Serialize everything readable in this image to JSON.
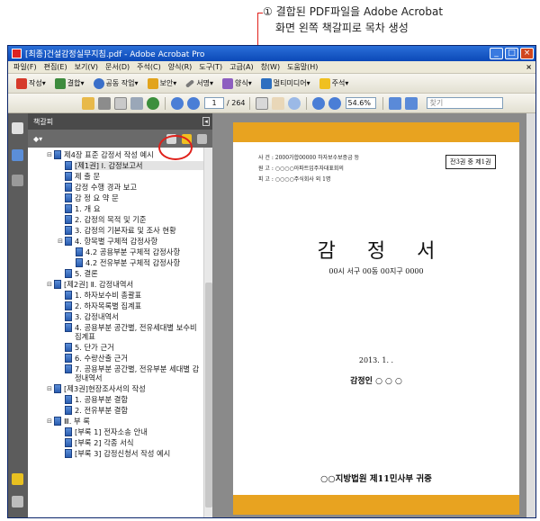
{
  "callout": {
    "number": "①",
    "line1": "결합된 PDF파일을 Adobe Acrobat",
    "line2": "화면 왼쪽 책갈피로 목차 생성"
  },
  "window": {
    "title": "[최종]건설감정실무지침.pdf - Adobe Acrobat Pro",
    "buttons": [
      "_",
      "□",
      "×"
    ]
  },
  "menubar": [
    "파일(F)",
    "편집(E)",
    "보기(V)",
    "문서(D)",
    "주석(C)",
    "양식(R)",
    "도구(T)",
    "고급(A)",
    "창(W)",
    "도움말(H)"
  ],
  "toolbar": {
    "create": "작성",
    "combine": "결합",
    "collaborate": "공동 작업",
    "secure": "보안",
    "sign": "서명",
    "forms": "양식",
    "multimedia": "멀티미디어",
    "comment": "주석"
  },
  "nav": {
    "current_page": "1",
    "total_pages": "/ 264",
    "zoom": "54.6%",
    "search_placeholder": "찾기"
  },
  "bookmarks": {
    "header": "책갈피",
    "options": "◆▾",
    "items": [
      {
        "label": "제4장 표준 감정서 작성 예시",
        "level": 0,
        "toggle": "⊟",
        "selected": false
      },
      {
        "label": "[제1권] Ⅰ. 감정보고서",
        "level": 1,
        "toggle": "",
        "selected": true
      },
      {
        "label": "제 출 문",
        "level": 1,
        "toggle": "",
        "selected": false
      },
      {
        "label": "감정 수행 경과 보고",
        "level": 1,
        "toggle": "",
        "selected": false
      },
      {
        "label": "감 정 요 약 문",
        "level": 1,
        "toggle": "",
        "selected": false
      },
      {
        "label": "1. 개 요",
        "level": 1,
        "toggle": "",
        "selected": false
      },
      {
        "label": "2. 감정의 목적 및 기준",
        "level": 1,
        "toggle": "",
        "selected": false
      },
      {
        "label": "3. 감정의 기본자료 및 조사 현황",
        "level": 1,
        "toggle": "",
        "selected": false
      },
      {
        "label": "4. 항목별 구체적 감정사항",
        "level": 1,
        "toggle": "⊟",
        "selected": false
      },
      {
        "label": "4.2 공용부분 구체적 감정사항",
        "level": 2,
        "toggle": "",
        "selected": false
      },
      {
        "label": "4.2 전유부분 구체적 감정사항",
        "level": 2,
        "toggle": "",
        "selected": false
      },
      {
        "label": "5. 결론",
        "level": 1,
        "toggle": "",
        "selected": false
      },
      {
        "label": "[제2권] Ⅱ. 감정내역서",
        "level": 0,
        "toggle": "⊟",
        "selected": false
      },
      {
        "label": "1. 하자보수비 총괄표",
        "level": 1,
        "toggle": "",
        "selected": false
      },
      {
        "label": "2. 하자목록별 집계표",
        "level": 1,
        "toggle": "",
        "selected": false
      },
      {
        "label": "3. 감정내역서",
        "level": 1,
        "toggle": "",
        "selected": false
      },
      {
        "label": "4. 공용부분 공간별, 전유세대별 보수비 집계표",
        "level": 1,
        "toggle": "",
        "selected": false
      },
      {
        "label": "5. 단가 근거",
        "level": 1,
        "toggle": "",
        "selected": false
      },
      {
        "label": "6. 수량산출 근거",
        "level": 1,
        "toggle": "",
        "selected": false
      },
      {
        "label": "7. 공용부분 공간별, 전유부분 세대별 감정내역서",
        "level": 1,
        "toggle": "",
        "selected": false
      },
      {
        "label": "[제3권]현장조사서의 작성",
        "level": 0,
        "toggle": "⊟",
        "selected": false
      },
      {
        "label": "1. 공용부분 결함",
        "level": 1,
        "toggle": "",
        "selected": false
      },
      {
        "label": "2. 전유부분 결함",
        "level": 1,
        "toggle": "",
        "selected": false
      },
      {
        "label": "Ⅲ. 부 록",
        "level": 0,
        "toggle": "⊟",
        "selected": false
      },
      {
        "label": "[부록 1] 전자소송 안내",
        "level": 1,
        "toggle": "",
        "selected": false
      },
      {
        "label": "[부록 2] 각종 서식",
        "level": 1,
        "toggle": "",
        "selected": false
      },
      {
        "label": "[부록 3] 감정신청서 작성 예시",
        "level": 1,
        "toggle": "",
        "selected": false
      }
    ]
  },
  "document": {
    "meta": [
      "사 건 : 2000가합00000 하자보수보증금 등",
      "원 고 : ○○○○아파트입주자대표회의",
      "피 고 : ○○○○주식회사 외 1명"
    ],
    "volume": "전3권 중 제1권",
    "title": "감 정 서",
    "subtitle": "00시 서구 00동 00지구 0000",
    "date": "2013. 1. .",
    "signer": "감정인  ○ ○ ○",
    "court": "○○지방법원 제11민사부 귀중"
  },
  "colors": {
    "accent_red": "#e0201a",
    "page_band": "#e8a320",
    "title_blue": "#0b49b8"
  }
}
